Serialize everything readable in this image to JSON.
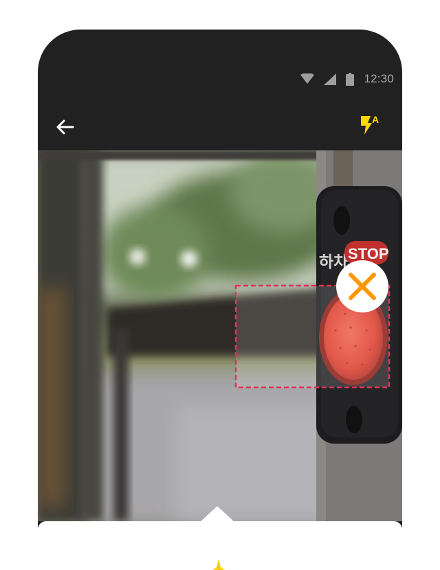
{
  "status_bar": {
    "time": "12:30",
    "icons": [
      "wifi-icon",
      "signal-icon",
      "battery-icon"
    ]
  },
  "app_bar": {
    "back_icon": "arrow-left-icon",
    "flash_icon": "flash-auto-icon",
    "flash_label": "A"
  },
  "viewfinder": {
    "sign_text": {
      "korean": "하차",
      "stop": "STOP"
    },
    "reject_icon": "close-icon",
    "colors": {
      "selection_border": "#e5305a",
      "reject_cross": "#ff9800",
      "button_red": "#e23c2e"
    }
  },
  "colors": {
    "app_bar_bg": "#212121",
    "accent": "#ffd600"
  }
}
